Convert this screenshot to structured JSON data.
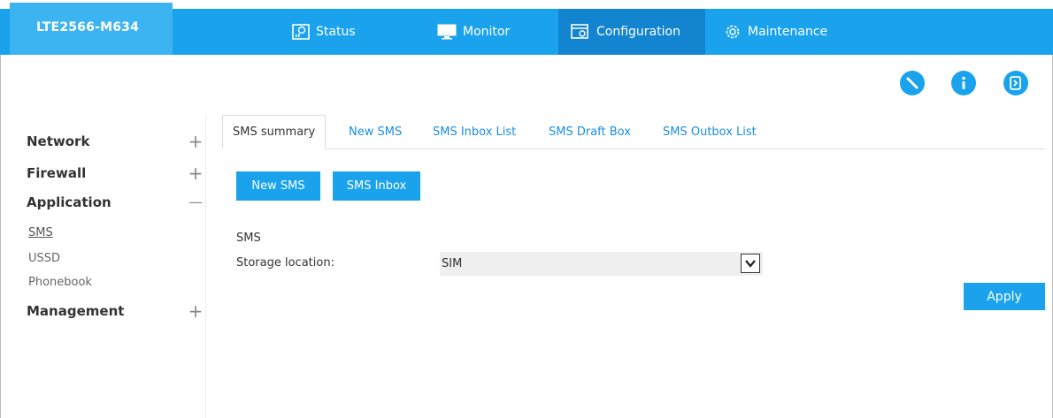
{
  "header": {
    "model": "LTE2566-M634",
    "nav": [
      {
        "label": "Status",
        "icon": "status-icon"
      },
      {
        "label": "Monitor",
        "icon": "monitor-icon"
      },
      {
        "label": "Configuration",
        "icon": "configuration-icon",
        "active": true
      },
      {
        "label": "Maintenance",
        "icon": "gear-icon"
      }
    ],
    "actions": [
      {
        "icon": "wizard-icon"
      },
      {
        "icon": "info-icon"
      },
      {
        "icon": "logout-icon"
      }
    ],
    "colors": {
      "bar": "#1aa3ec",
      "active": "#1284d0",
      "model_bg": "#3db4f2"
    }
  },
  "sidebar": {
    "groups": [
      {
        "label": "Network",
        "toggle": "+"
      },
      {
        "label": "Firewall",
        "toggle": "+"
      },
      {
        "label": "Application",
        "toggle": "—",
        "items": [
          "SMS",
          "USSD",
          "Phonebook"
        ]
      },
      {
        "label": "Management",
        "toggle": "+"
      }
    ]
  },
  "tabs": [
    "SMS summary",
    "New SMS",
    "SMS Inbox List",
    "SMS Draft Box",
    "SMS Outbox List"
  ],
  "buttons": {
    "new_sms": "New SMS",
    "sms_inbox": "SMS Inbox",
    "apply": "Apply"
  },
  "form": {
    "section_title": "SMS",
    "storage_label": "Storage location:",
    "storage_value": "SIM"
  }
}
